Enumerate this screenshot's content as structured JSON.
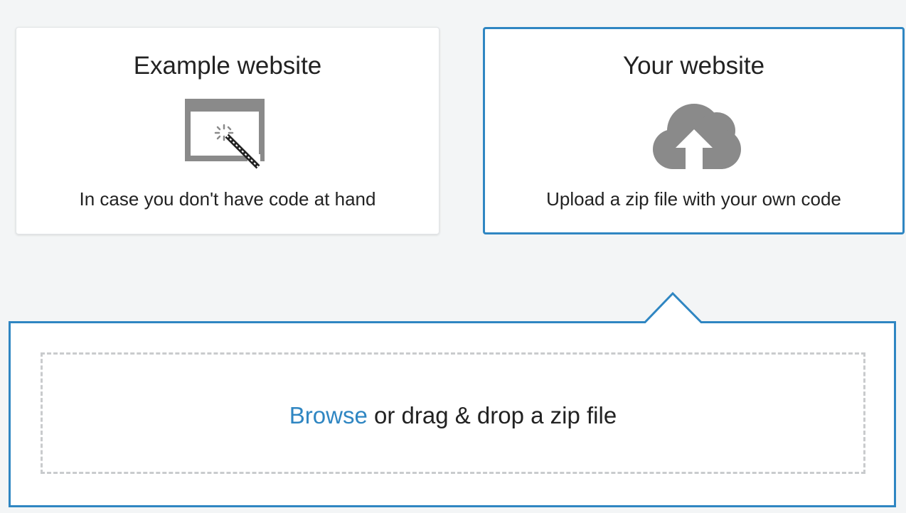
{
  "cards": {
    "example": {
      "title": "Example website",
      "description": "In case you don't have code at hand",
      "icon": "browser-magic-wand-icon",
      "selected": false
    },
    "yours": {
      "title": "Your website",
      "description": "Upload a zip file with your own code",
      "icon": "cloud-upload-icon",
      "selected": true
    }
  },
  "upload": {
    "browse_label": "Browse",
    "drop_text": " or drag & drop a zip file"
  },
  "colors": {
    "accent": "#2f86c2",
    "background": "#f3f5f6",
    "icon_gray": "#8a8a8a",
    "dashed_border": "#c9cbcd"
  }
}
